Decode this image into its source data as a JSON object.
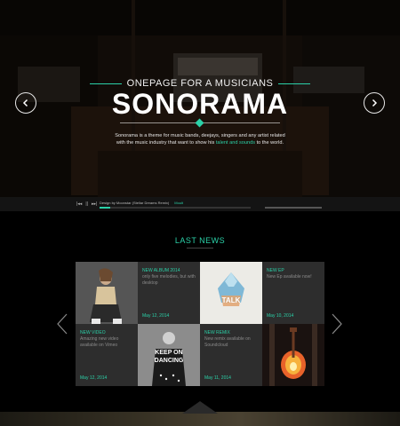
{
  "hero": {
    "tagline": "ONEPAGE FOR A MUSICIANS",
    "brand": "SONORAMA",
    "desc_line1": "Sonorama is a theme for music bands, deejays, singers and any artist related",
    "desc_line2_pre": "with the music industry that want to show his ",
    "desc_line2_hl": "talent and sounds",
    "desc_line2_post": " to the world.",
    "accent_color": "#2bd1a8",
    "prev_icon": "chevron-left-icon",
    "next_icon": "chevron-right-icon"
  },
  "player": {
    "controls": [
      "prev",
      "pause",
      "next"
    ],
    "controls_glyphs": [
      "|◂◂",
      "||",
      "▸▸|"
    ],
    "track_title": "Design by Moonstar (Stellar Dreams Remix)",
    "track_author": "Moult",
    "progress_fraction": 0.07
  },
  "news": {
    "title": "LAST NEWS",
    "items": [
      {
        "type": "image",
        "icon": "singer-photo"
      },
      {
        "type": "card",
        "label": "NEW ALBUM 2014",
        "text": "only five melodies, but with desktop",
        "date": "May 12, 2014"
      },
      {
        "type": "image",
        "icon": "album-cover-talk",
        "cover_text": "TALK"
      },
      {
        "type": "card",
        "label": "NEW EP",
        "text": "New Ep available now!",
        "date": "May 10, 2014"
      },
      {
        "type": "card",
        "label": "NEW VIDEO",
        "text": "Amazing new video available on Vimeo",
        "date": "May 12, 2014"
      },
      {
        "type": "image",
        "icon": "keep-on-dancing-poster",
        "cover_text_1": "KEEP ON",
        "cover_text_2": "DANCING"
      },
      {
        "type": "card",
        "label": "NEW REMIX",
        "text": "New remix available on Soundcloud",
        "date": "May 11, 2014"
      },
      {
        "type": "image",
        "icon": "guitar-on-fire"
      }
    ]
  }
}
